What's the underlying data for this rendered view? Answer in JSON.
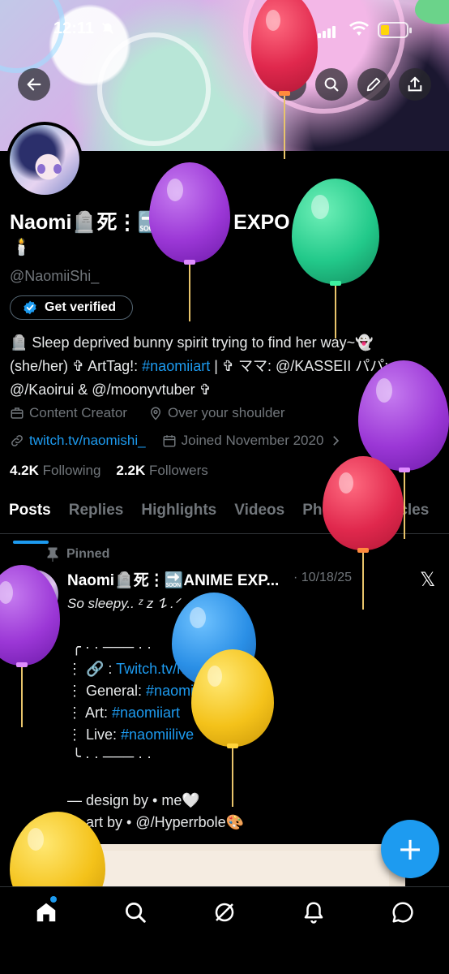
{
  "status_bar": {
    "time": "12:11"
  },
  "header": {
    "back_icon": "back-arrow-icon",
    "grok_icon": "grok-icon",
    "search_icon": "search-icon",
    "edit_icon": "pencil-icon",
    "share_icon": "share-icon"
  },
  "profile": {
    "name": "Naomi🪦死⋮🔜ANIME EXPO 2026🐇",
    "name_line2": "🕯️",
    "handle": "@NaomiiShi_",
    "get_verified": "Get verified",
    "bio_line1": "🪦 Sleep deprived bunny spirit trying to find her way~👻",
    "bio_line2_a": "(she/her) ✞ ArtTag!: ",
    "bio_line2_link": "#naomiiart",
    "bio_line2_b": " | ✞ ママ: @/KASSEII パパ:",
    "bio_line3": "@/Kaoirui & @/moonyvtuber ✞",
    "category": "Content Creator",
    "location": "Over your shoulder",
    "website": "twitch.tv/naomishi_",
    "joined": "Joined November 2020",
    "following_count": "4.2K",
    "following_label": "Following",
    "followers_count": "2.2K",
    "followers_label": "Followers"
  },
  "tabs": [
    "Posts",
    "Replies",
    "Highlights",
    "Videos",
    "Photos",
    "Articles"
  ],
  "pinned_post": {
    "pinned_label": "Pinned",
    "author": "Naomi🪦死⋮🔜ANIME EXP...",
    "date": "· 10/18/25",
    "line1": "So sleepy.. ᶻ z 𐰁 .ᐟ",
    "line2": "╭ · · ─── · ·",
    "line3_prefix": "⋮  🔗 : ",
    "line3_link": "Twitch.tv/naomishi",
    "line4_prefix": "⋮  General: ",
    "line4_link": "#naomiigraveyard",
    "line5_prefix": "⋮  Art: ",
    "line5_link": "#naomiiart",
    "line6_prefix": "⋮  Live: ",
    "line6_link": "#naomiilive",
    "line7": "╰ · · ─── · ·",
    "line8": "— design by • me🤍",
    "line9": "— art by • @/Hyperrbole🎨"
  },
  "fab_label": "+",
  "colors": {
    "accent": "#1d9bf0",
    "background": "#000000",
    "muted": "#71767b"
  },
  "balloons": [
    "red",
    "purple",
    "green",
    "purple",
    "red",
    "purple",
    "blue",
    "yellow",
    "yellow"
  ]
}
